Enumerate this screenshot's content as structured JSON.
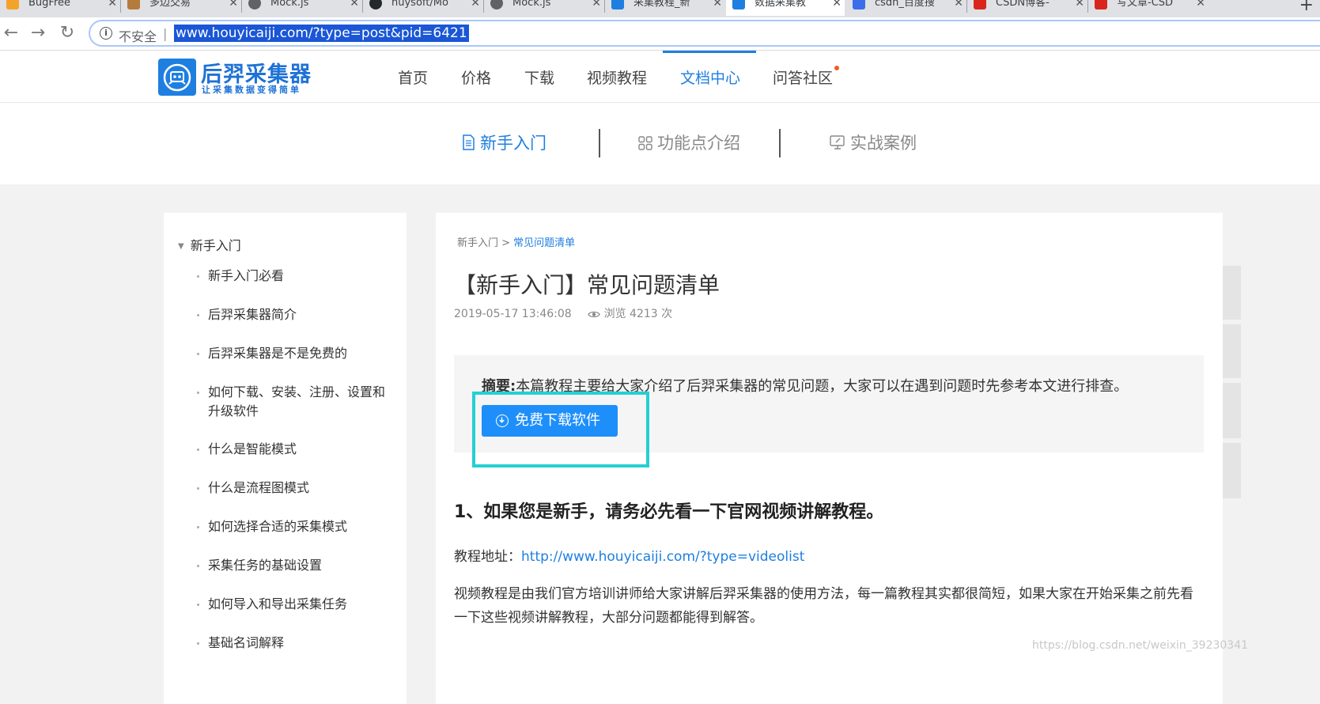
{
  "browser": {
    "tabs": [
      {
        "title": "BugFree",
        "color": "#f4a32a"
      },
      {
        "title": "多边交易",
        "color": "#b57b3c"
      },
      {
        "title": "Mock.js",
        "color": "#5f6368"
      },
      {
        "title": "nuysoft/Mo",
        "color": "#24292e"
      },
      {
        "title": "Mock.js",
        "color": "#5f6368"
      },
      {
        "title": "采集教程_新",
        "color": "#1e7fe0"
      },
      {
        "title": "数据采集教",
        "color": "#1e7fe0"
      },
      {
        "title": "csdn_百度搜",
        "color": "#3b6ee8"
      },
      {
        "title": "CSDN博客-",
        "color": "#d9261c"
      },
      {
        "title": "写文章-CSD",
        "color": "#d9261c"
      }
    ],
    "insecure_label": "不安全",
    "url": "www.houyicaiji.com/?type=post&pid=6421"
  },
  "site": {
    "logo_title": "后羿采集器",
    "logo_subtitle": "让采集数据变得简单",
    "nav": [
      "首页",
      "价格",
      "下载",
      "视频教程",
      "文档中心",
      "问答社区"
    ]
  },
  "doc_tabs": [
    "新手入门",
    "功能点介绍",
    "实战案例"
  ],
  "sidebar": {
    "heading": "新手入门",
    "items": [
      "新手入门必看",
      "后羿采集器简介",
      "后羿采集器是不是免费的",
      "如何下载、安装、注册、设置和升级软件",
      "什么是智能模式",
      "什么是流程图模式",
      "如何选择合适的采集模式",
      "采集任务的基础设置",
      "如何导入和导出采集任务",
      "基础名词解释"
    ]
  },
  "article": {
    "breadcrumb_parent": "新手入门 >",
    "breadcrumb_current": "常见问题清单",
    "title": "【新手入门】常见问题清单",
    "date": "2019-05-17 13:46:08",
    "views": "浏览 4213 次",
    "summary_label": "摘要:",
    "summary_text": "本篇教程主要给大家介绍了后羿采集器的常见问题，大家可以在遇到问题时先参考本文进行排查。",
    "download_button": "免费下载软件",
    "section_title": "1、如果您是新手，请务必先看一下官网视频讲解教程。",
    "tutorial_label": "教程地址：",
    "tutorial_link": "http://www.houyicaiji.com/?type=videolist",
    "paragraph": "视频教程是由我们官方培训讲师给大家讲解后羿采集器的使用方法，每一篇教程其实都很简短，如果大家在开始采集之前先看一下这些视频讲解教程，大部分问题都能得到解答。"
  },
  "watermark": "https://blog.csdn.net/weixin_39230341",
  "colors": {
    "accent": "#1e7fe0",
    "highlight": "#23d0d4",
    "button": "#1e8ffa"
  }
}
